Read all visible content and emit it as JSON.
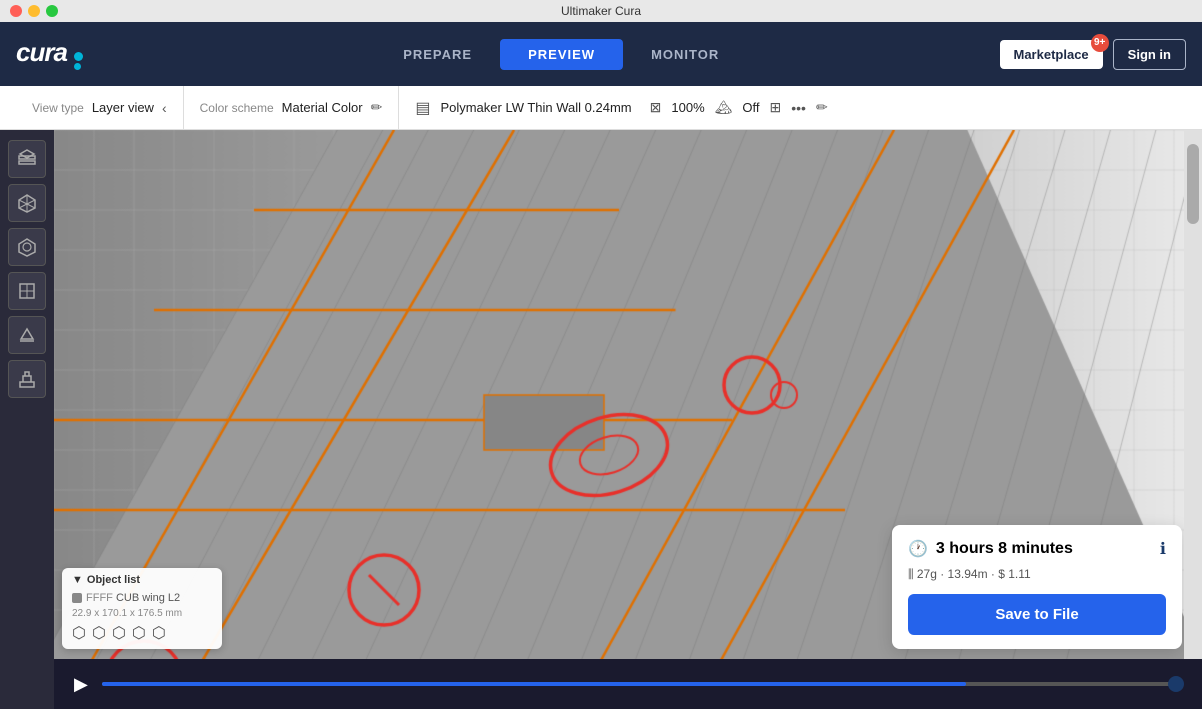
{
  "window": {
    "title": "Ultimaker Cura"
  },
  "nav": {
    "items": [
      {
        "id": "prepare",
        "label": "PREPARE"
      },
      {
        "id": "preview",
        "label": "PREVIEW"
      },
      {
        "id": "monitor",
        "label": "MONITOR"
      }
    ],
    "active": "preview"
  },
  "header": {
    "marketplace_label": "Marketplace",
    "marketplace_badge": "9+",
    "signin_label": "Sign in",
    "logo_text": "cura"
  },
  "toolbar": {
    "view_type_label": "View type",
    "view_type_value": "Layer view",
    "color_scheme_label": "Color scheme",
    "color_scheme_value": "Material Color",
    "printer_name": "Polymaker LW Thin Wall 0.24mm",
    "fill_pct": "100%",
    "support_label": "Off"
  },
  "sidebar": {
    "buttons": [
      {
        "id": "tool1",
        "icon": "⬡"
      },
      {
        "id": "tool2",
        "icon": "⬡"
      },
      {
        "id": "tool3",
        "icon": "⬡"
      },
      {
        "id": "tool4",
        "icon": "⬡"
      },
      {
        "id": "tool5",
        "icon": "⬡"
      },
      {
        "id": "tool6",
        "icon": "⬡"
      }
    ]
  },
  "object_list": {
    "header": "Object list",
    "item_name": "CUB wing L2",
    "item_prefix": "FFFF",
    "dimensions": "22.9 x 170.1 x 176.5 mm"
  },
  "info_panel": {
    "time": "3 hours 8 minutes",
    "stats": "27g · 13.94m · $ 1.11",
    "save_button": "Save to File"
  },
  "colors": {
    "header_bg": "#1e2a45",
    "nav_active": "#2563eb",
    "toolbar_bg": "#ffffff",
    "viewport_bg": "#c8c8c8",
    "sidebar_bg": "#2a2a3a",
    "info_panel_bg": "#ffffff",
    "save_btn_bg": "#2563eb",
    "bottom_bar_bg": "#1a1a2e"
  }
}
